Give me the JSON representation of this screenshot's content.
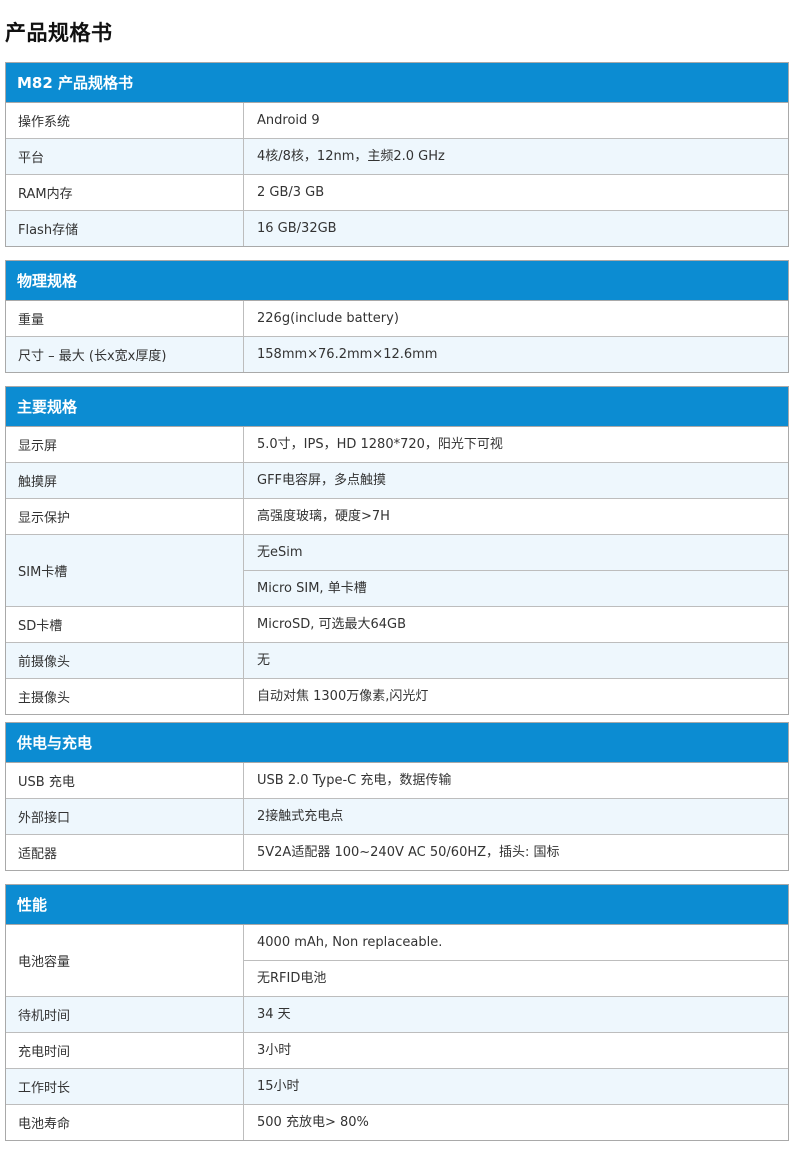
{
  "page_title": "产品规格书",
  "sections": [
    {
      "title": "M82 产品规格书",
      "rows": [
        {
          "label": "操作系统",
          "values": [
            "Android 9"
          ]
        },
        {
          "label": "平台",
          "values": [
            "4核/8核，12nm，主频2.0 GHz"
          ]
        },
        {
          "label": "RAM内存",
          "values": [
            "2 GB/3 GB"
          ]
        },
        {
          "label": "Flash存储",
          "values": [
            "16 GB/32GB"
          ]
        }
      ]
    },
    {
      "title": "物理规格",
      "rows": [
        {
          "label": "重量",
          "values": [
            "226g(include battery)"
          ]
        },
        {
          "label": "尺寸 – 最大 (长x宽x厚度)",
          "values": [
            "158mm×76.2mm×12.6mm"
          ]
        }
      ]
    },
    {
      "title": "主要规格",
      "rows": [
        {
          "label": "显示屏",
          "values": [
            "5.0寸，IPS，HD 1280*720，阳光下可视"
          ]
        },
        {
          "label": "触摸屏",
          "values": [
            "GFF电容屏，多点触摸"
          ]
        },
        {
          "label": "显示保护",
          "values": [
            "高强度玻璃，硬度>7H"
          ]
        },
        {
          "label": "SIM卡槽",
          "values": [
            "无eSim",
            "Micro SIM, 单卡槽"
          ]
        },
        {
          "label": "SD卡槽",
          "values": [
            "MicroSD, 可选最大64GB"
          ]
        },
        {
          "label": "前摄像头",
          "values": [
            "无"
          ]
        },
        {
          "label": "主摄像头",
          "values": [
            "自动对焦 1300万像素,闪光灯"
          ]
        }
      ]
    },
    {
      "title": "供电与充电",
      "rows": [
        {
          "label": "USB 充电",
          "values": [
            "USB 2.0 Type-C 充电，数据传输"
          ]
        },
        {
          "label": "外部接口",
          "values": [
            "2接触式充电点"
          ]
        },
        {
          "label": "适配器",
          "values": [
            "5V2A适配器 100~240V AC 50/60HZ，插头: 国标"
          ]
        }
      ]
    },
    {
      "title": "性能",
      "rows": [
        {
          "label": "电池容量",
          "values": [
            "4000 mAh, Non replaceable.",
            "无RFID电池"
          ]
        },
        {
          "label": "待机时间",
          "values": [
            "34 天"
          ]
        },
        {
          "label": "充电时间",
          "values": [
            "3小时"
          ]
        },
        {
          "label": "工作时长",
          "values": [
            "15小时"
          ]
        },
        {
          "label": "电池寿命",
          "values": [
            "500 充放电> 80%"
          ]
        }
      ]
    }
  ]
}
